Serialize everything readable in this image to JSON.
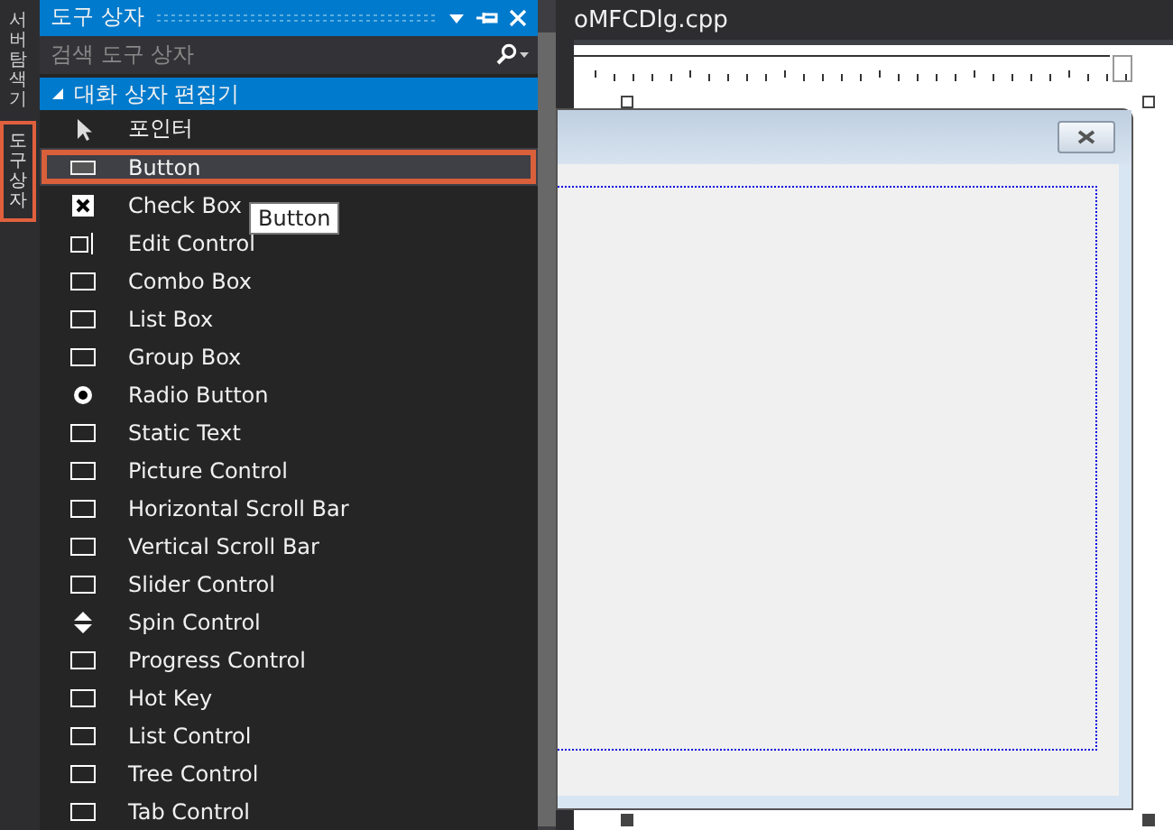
{
  "side_tabs": [
    {
      "label": "서버 탐색기",
      "selected": false
    },
    {
      "label": "도구 상자",
      "selected": true
    }
  ],
  "toolbox": {
    "title": "도구 상자",
    "search": {
      "placeholder": "검색 도구 상자"
    },
    "group": {
      "label": "대화 상자 편집기",
      "expanded": true
    },
    "items": [
      {
        "label": "포인터",
        "selected": false
      },
      {
        "label": "Button",
        "selected": true
      },
      {
        "label": "Check Box",
        "selected": false
      },
      {
        "label": "Edit Control",
        "selected": false
      },
      {
        "label": "Combo Box",
        "selected": false
      },
      {
        "label": "List Box",
        "selected": false
      },
      {
        "label": "Group Box",
        "selected": false
      },
      {
        "label": "Radio Button",
        "selected": false
      },
      {
        "label": "Static Text",
        "selected": false
      },
      {
        "label": "Picture Control",
        "selected": false
      },
      {
        "label": "Horizontal Scroll Bar",
        "selected": false
      },
      {
        "label": "Vertical Scroll Bar",
        "selected": false
      },
      {
        "label": "Slider Control",
        "selected": false
      },
      {
        "label": "Spin Control",
        "selected": false
      },
      {
        "label": "Progress Control",
        "selected": false
      },
      {
        "label": "Hot Key",
        "selected": false
      },
      {
        "label": "List Control",
        "selected": false
      },
      {
        "label": "Tree Control",
        "selected": false
      },
      {
        "label": "Tab Control",
        "selected": false
      }
    ],
    "tooltip": "Button"
  },
  "editor": {
    "tab": "oMFCDlg.cpp"
  }
}
